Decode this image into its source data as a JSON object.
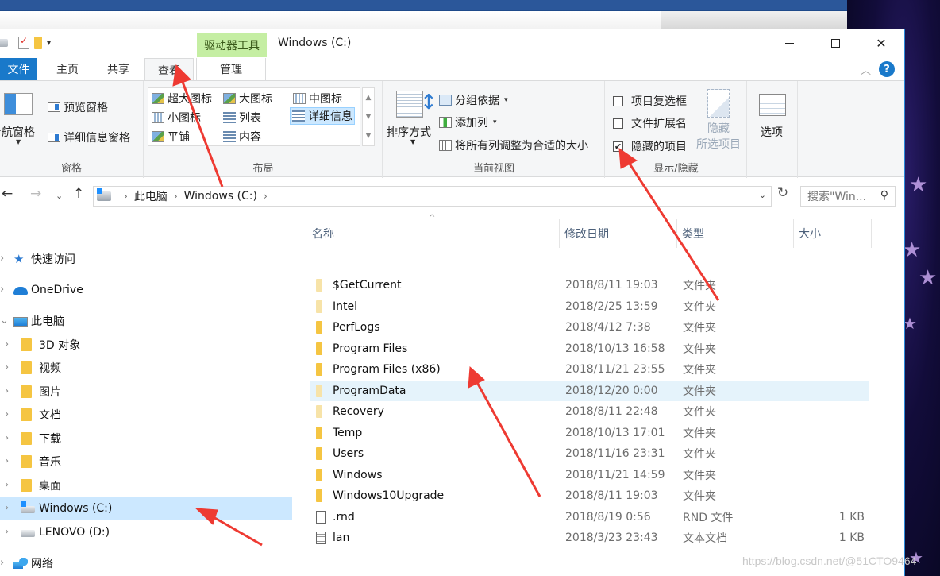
{
  "window": {
    "title": "Windows (C:)",
    "context_tab": "驱动器工具",
    "caption": {
      "minimize": "–",
      "maximize": "□",
      "close": "✕"
    }
  },
  "ribbon_tabs": [
    {
      "label": "文件",
      "active": false
    },
    {
      "label": "主页",
      "active": false
    },
    {
      "label": "共享",
      "active": false
    },
    {
      "label": "查看",
      "active": true
    },
    {
      "label": "管理",
      "active": false
    }
  ],
  "ribbon": {
    "pane": {
      "label": "窗格",
      "nav_pane": "导航窗格",
      "preview_pane": "预览窗格",
      "details_pane": "详细信息窗格"
    },
    "layout": {
      "label": "布局",
      "items": [
        "超大图标",
        "大图标",
        "中图标",
        "小图标",
        "列表",
        "详细信息",
        "平铺",
        "内容"
      ],
      "selected": "详细信息"
    },
    "current_view": {
      "label": "当前视图",
      "sort_by": "排序方式",
      "group_by": "分组依据",
      "add_column": "添加列",
      "fit_columns": "将所有列调整为合适的大小"
    },
    "show_hide": {
      "label": "显示/隐藏",
      "item_checkboxes": {
        "label": "项目复选框",
        "checked": false
      },
      "file_extensions": {
        "label": "文件扩展名",
        "checked": false
      },
      "hidden_items": {
        "label": "隐藏的项目",
        "checked": true
      },
      "hide_selected_line1": "隐藏",
      "hide_selected_line2": "所选项目"
    },
    "options": {
      "label": "选项"
    }
  },
  "address": {
    "crumbs": [
      "此电脑",
      "Windows (C:)"
    ],
    "search_placeholder": "搜索\"Win...",
    "back": "←",
    "forward": "→",
    "recent": "⌄",
    "up": "↑",
    "refresh": "↻",
    "dropdown": "⌄",
    "search_icon": "⚲"
  },
  "nav_pane": [
    {
      "label": "快速访问",
      "icon": "star-icon"
    },
    {
      "label": "OneDrive",
      "icon": "cloud-icon"
    },
    {
      "label": "此电脑",
      "icon": "computer-icon"
    },
    {
      "label": "3D 对象",
      "icon": "3d-objects-folder-icon"
    },
    {
      "label": "视频",
      "icon": "videos-folder-icon"
    },
    {
      "label": "图片",
      "icon": "pictures-folder-icon"
    },
    {
      "label": "文档",
      "icon": "documents-folder-icon"
    },
    {
      "label": "下载",
      "icon": "downloads-folder-icon"
    },
    {
      "label": "音乐",
      "icon": "music-folder-icon"
    },
    {
      "label": "桌面",
      "icon": "desktop-folder-icon"
    },
    {
      "label": "Windows (C:)",
      "icon": "drive-c-icon",
      "selected": true
    },
    {
      "label": "LENOVO (D:)",
      "icon": "drive-d-icon"
    },
    {
      "label": "网络",
      "icon": "network-icon"
    }
  ],
  "columns": {
    "name": "名称",
    "date": "修改日期",
    "type": "类型",
    "size": "大小"
  },
  "files": [
    {
      "name": "$GetCurrent",
      "date": "2018/8/11 19:03",
      "type": "文件夹",
      "size": "",
      "hidden": true
    },
    {
      "name": "Intel",
      "date": "2018/2/25 13:59",
      "type": "文件夹",
      "size": "",
      "hidden": true
    },
    {
      "name": "PerfLogs",
      "date": "2018/4/12 7:38",
      "type": "文件夹",
      "size": ""
    },
    {
      "name": "Program Files",
      "date": "2018/10/13 16:58",
      "type": "文件夹",
      "size": ""
    },
    {
      "name": "Program Files (x86)",
      "date": "2018/11/21 23:55",
      "type": "文件夹",
      "size": ""
    },
    {
      "name": "ProgramData",
      "date": "2018/12/20 0:00",
      "type": "文件夹",
      "size": "",
      "hidden": true,
      "highlighted": true
    },
    {
      "name": "Recovery",
      "date": "2018/8/11 22:48",
      "type": "文件夹",
      "size": "",
      "hidden": true
    },
    {
      "name": "Temp",
      "date": "2018/10/13 17:01",
      "type": "文件夹",
      "size": ""
    },
    {
      "name": "Users",
      "date": "2018/11/16 23:31",
      "type": "文件夹",
      "size": ""
    },
    {
      "name": "Windows",
      "date": "2018/11/21 14:59",
      "type": "文件夹",
      "size": ""
    },
    {
      "name": "Windows10Upgrade",
      "date": "2018/8/11 19:03",
      "type": "文件夹",
      "size": ""
    },
    {
      "name": ".rnd",
      "date": "2018/8/19 0:56",
      "type": "RND 文件",
      "size": "1 KB",
      "kind": "file"
    },
    {
      "name": "lan",
      "date": "2018/3/23 23:43",
      "type": "文本文档",
      "size": "1 KB",
      "kind": "txt"
    }
  ],
  "watermark": "https://blog.csdn.net/@51CTO9464",
  "colors": {
    "accent": "#1979ca",
    "context_tab": "#c5eea3",
    "selection": "#cce8ff",
    "arrow": "#ee3a32"
  }
}
